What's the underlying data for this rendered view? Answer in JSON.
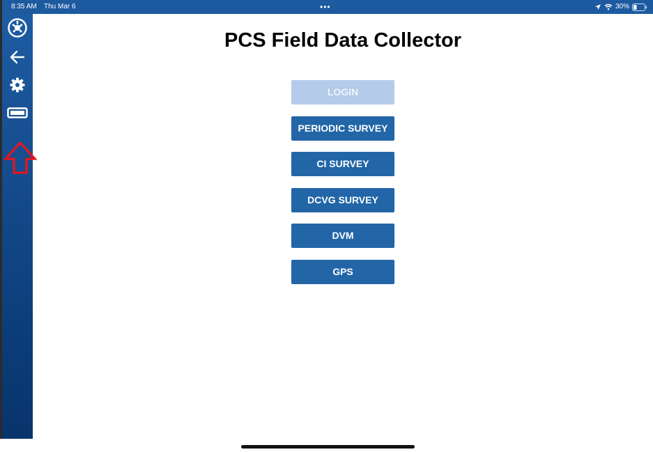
{
  "status_bar": {
    "time": "8:35 AM",
    "date": "Thu Mar 6",
    "dots": "•••",
    "battery_percent": "30%",
    "battery_level": 0.3,
    "icons": [
      "location-icon",
      "wifi-icon",
      "battery-icon"
    ]
  },
  "sidebar": {
    "items": [
      {
        "icon": "app-logo-icon"
      },
      {
        "icon": "back-arrow-icon"
      },
      {
        "icon": "gear-icon"
      },
      {
        "icon": "battery-outline-icon"
      }
    ],
    "annotation": {
      "icon": "up-arrow-outline-icon",
      "color": "#e8141c"
    }
  },
  "main": {
    "title": "PCS Field Data Collector",
    "buttons": [
      {
        "label": "LOGIN",
        "enabled": false
      },
      {
        "label": "PERIODIC SURVEY",
        "enabled": true
      },
      {
        "label": "CI SURVEY",
        "enabled": true
      },
      {
        "label": "DCVG SURVEY",
        "enabled": true
      },
      {
        "label": "DVM",
        "enabled": true
      },
      {
        "label": "GPS",
        "enabled": true
      }
    ]
  },
  "colors": {
    "accent": "#2266a8",
    "sidebar": "#1e5ca2",
    "disabled_button": "#b4cbea",
    "status_bar": "#1d5aa0"
  }
}
